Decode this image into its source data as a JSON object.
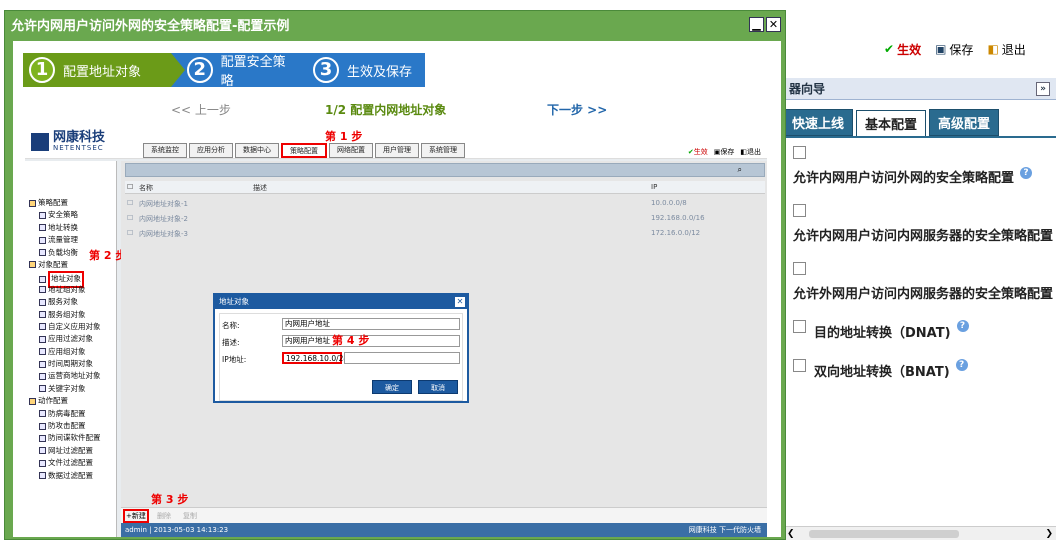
{
  "background": {
    "toolbar": {
      "apply": "生效",
      "save": "保存",
      "exit": "退出"
    }
  },
  "right_panel": {
    "title": "器向导",
    "tabs": [
      "快速上线",
      "基本配置",
      "高级配置"
    ],
    "items": [
      {
        "label": "允许内网用户访问外网的安全策略配置"
      },
      {
        "label": "允许内网用户访问内网服务器的安全策略配置"
      },
      {
        "label": "允许外网用户访问内网服务器的安全策略配置"
      },
      {
        "label": "目的地址转换（DNAT)"
      },
      {
        "label": "双向地址转换（BNAT)"
      }
    ]
  },
  "modal": {
    "title": "允许内网用户访问外网的安全策略配置-配置示例",
    "steps": [
      {
        "num": "1",
        "label": "配置地址对象"
      },
      {
        "num": "2",
        "label": "配置安全策略"
      },
      {
        "num": "3",
        "label": "生效及保存"
      }
    ],
    "nav": {
      "prev": "<< 上一步",
      "current": "1/2 配置内网地址对象",
      "next": "下一步 >>"
    }
  },
  "screenshot": {
    "logo_cn": "网康科技",
    "logo_en": "NETENTSEC",
    "tabs": [
      "系统监控",
      "应用分析",
      "数据中心",
      "策略配置",
      "网络配置",
      "用户管理",
      "系统管理"
    ],
    "selected_tab": 3,
    "tools": {
      "apply": "生效",
      "save": "保存",
      "exit": "退出"
    },
    "annotations": {
      "step1": "第 1 步",
      "step2": "第 2 步",
      "step3": "第 3 步",
      "step4": "第 4 步"
    },
    "tree": [
      {
        "type": "group",
        "label": "策略配置"
      },
      {
        "type": "child",
        "label": "安全策略"
      },
      {
        "type": "child",
        "label": "地址转换"
      },
      {
        "type": "child",
        "label": "流量管理"
      },
      {
        "type": "child",
        "label": "负载均衡"
      },
      {
        "type": "group",
        "label": "对象配置"
      },
      {
        "type": "child",
        "label": "地址对象",
        "highlight": true
      },
      {
        "type": "child",
        "label": "地址组对象"
      },
      {
        "type": "child",
        "label": "服务对象"
      },
      {
        "type": "child",
        "label": "服务组对象"
      },
      {
        "type": "child",
        "label": "自定义应用对象"
      },
      {
        "type": "child",
        "label": "应用过滤对象"
      },
      {
        "type": "child",
        "label": "应用组对象"
      },
      {
        "type": "child",
        "label": "时间周期对象"
      },
      {
        "type": "child",
        "label": "运营商地址对象"
      },
      {
        "type": "child",
        "label": "关键字对象"
      },
      {
        "type": "group",
        "label": "动作配置"
      },
      {
        "type": "child",
        "label": "防病毒配置"
      },
      {
        "type": "child",
        "label": "防攻击配置"
      },
      {
        "type": "child",
        "label": "防间谍软件配置"
      },
      {
        "type": "child",
        "label": "网址过滤配置"
      },
      {
        "type": "child",
        "label": "文件过滤配置"
      },
      {
        "type": "child",
        "label": "数据过滤配置"
      }
    ],
    "grid": {
      "headers": [
        "名称",
        "描述",
        "IP"
      ],
      "rows": [
        {
          "name": "内网地址对象-1",
          "desc": "",
          "ip": "10.0.0.0/8"
        },
        {
          "name": "内网地址对象-2",
          "desc": "",
          "ip": "192.168.0.0/16"
        },
        {
          "name": "内网地址对象-3",
          "desc": "",
          "ip": "172.16.0.0/12"
        }
      ]
    },
    "bottom": {
      "new": "新建",
      "delete": "删除",
      "copy": "复制"
    },
    "status": {
      "left": "admin | 2013-05-03 14:13:23",
      "right": "网康科技 下一代防火墙"
    },
    "dialog": {
      "title": "地址对象",
      "name_label": "名称:",
      "name_value": "内网用户地址",
      "desc_label": "描述:",
      "desc_value": "内网用户地址",
      "ip_label": "IP地址:",
      "ip_value": "192.168.10.0/24",
      "ok": "确定",
      "cancel": "取消"
    }
  }
}
